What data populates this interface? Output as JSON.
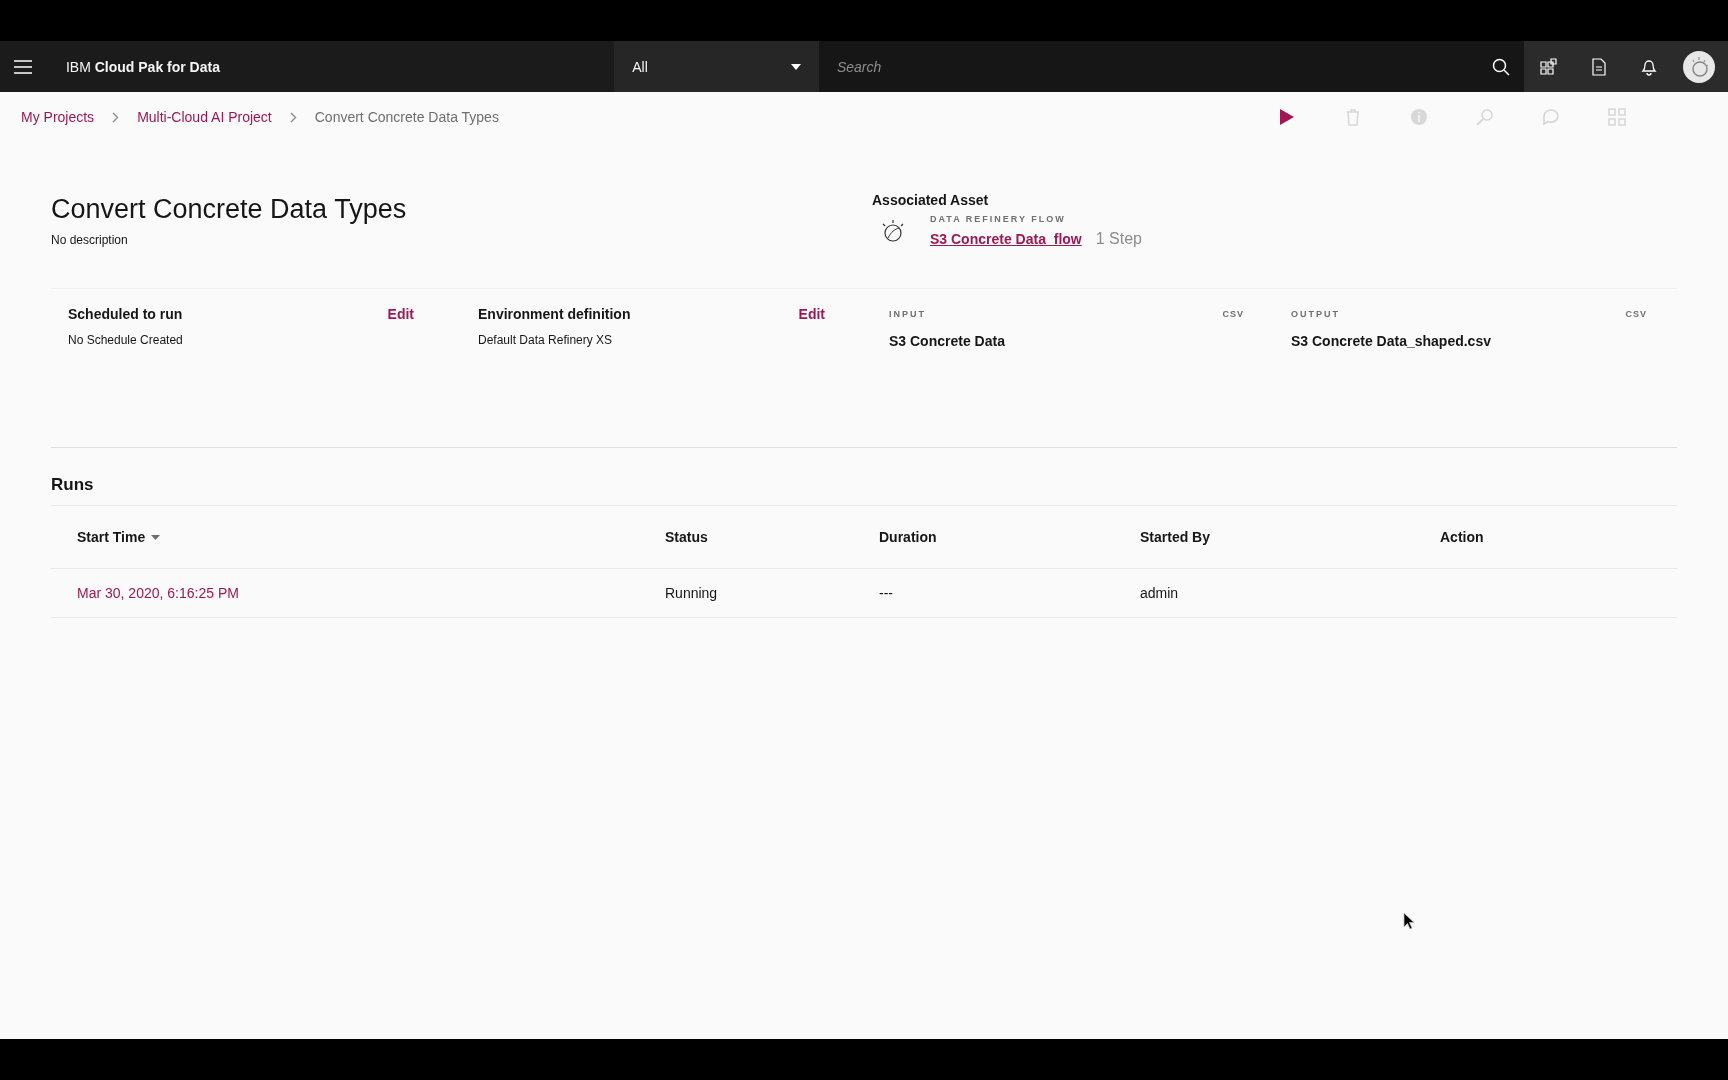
{
  "header": {
    "brand_prefix": "IBM",
    "brand_name": "Cloud Pak for Data",
    "scope_dropdown": {
      "value": "All"
    },
    "search": {
      "placeholder": "Search"
    },
    "icons": [
      {
        "kind": "apps"
      },
      {
        "kind": "document"
      },
      {
        "kind": "bell"
      },
      {
        "kind": "avatar"
      }
    ]
  },
  "breadcrumbs": [
    {
      "label": "My Projects",
      "link": true
    },
    {
      "label": "Multi-Cloud AI Project",
      "link": true
    },
    {
      "label": "Convert Concrete Data Types",
      "link": false
    }
  ],
  "toolbar": [
    {
      "kind": "run",
      "disabled": false
    },
    {
      "kind": "delete",
      "disabled": true
    },
    {
      "kind": "info",
      "disabled": true
    },
    {
      "kind": "edit",
      "disabled": true
    },
    {
      "kind": "comment",
      "disabled": true
    },
    {
      "kind": "grid",
      "disabled": true
    }
  ],
  "job": {
    "title": "Convert Concrete Data Types",
    "description": "No description"
  },
  "associated_asset": {
    "heading": "Associated Asset",
    "type_label": "DATA REFINERY FLOW",
    "name": "S3 Concrete Data_flow",
    "steps": "1 Step"
  },
  "details": [
    {
      "kind": "setting",
      "label": "Scheduled to run",
      "action": "Edit",
      "value": "No Schedule Created"
    },
    {
      "kind": "setting",
      "label": "Environment definition",
      "action": "Edit",
      "value": "Default Data Refinery XS"
    },
    {
      "kind": "data",
      "label": "INPUT",
      "format": "CSV",
      "value": "S3 Concrete Data"
    },
    {
      "kind": "data",
      "label": "OUTPUT",
      "format": "CSV",
      "value": "S3 Concrete Data_shaped.csv"
    }
  ],
  "runs": {
    "title": "Runs",
    "columns": [
      {
        "label": "Start Time",
        "sorted": true
      },
      {
        "label": "Status",
        "sorted": false
      },
      {
        "label": "Duration",
        "sorted": false
      },
      {
        "label": "Started By",
        "sorted": false
      },
      {
        "label": "Action",
        "sorted": false
      }
    ],
    "rows": [
      [
        "Mar 30, 2020, 6:16:25 PM",
        "Running",
        "---",
        "admin",
        ""
      ]
    ]
  }
}
